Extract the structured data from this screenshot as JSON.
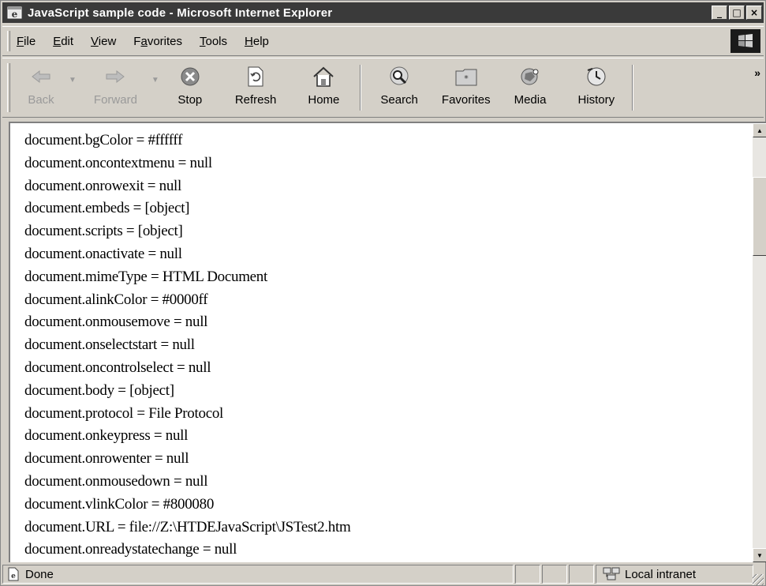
{
  "window": {
    "title": "JavaScript sample code - Microsoft Internet Explorer",
    "buttons": {
      "minimize": "_",
      "maximize": "□",
      "close": "×"
    }
  },
  "menu": {
    "items": [
      {
        "label": "File",
        "accel": "F"
      },
      {
        "label": "Edit",
        "accel": "E"
      },
      {
        "label": "View",
        "accel": "V"
      },
      {
        "label": "Favorites",
        "accel": "a"
      },
      {
        "label": "Tools",
        "accel": "T"
      },
      {
        "label": "Help",
        "accel": "H"
      }
    ]
  },
  "toolbar": {
    "back": "Back",
    "forward": "Forward",
    "stop": "Stop",
    "refresh": "Refresh",
    "home": "Home",
    "search": "Search",
    "favorites": "Favorites",
    "media": "Media",
    "history": "History",
    "more": "»"
  },
  "content": {
    "lines": [
      "document.bgColor = #ffffff",
      "document.oncontextmenu = null",
      "document.onrowexit = null",
      "document.embeds = [object]",
      "document.scripts = [object]",
      "document.onactivate = null",
      "document.mimeType = HTML Document",
      "document.alinkColor = #0000ff",
      "document.onmousemove = null",
      "document.onselectstart = null",
      "document.oncontrolselect = null",
      "document.body = [object]",
      "document.protocol = File Protocol",
      "document.onkeypress = null",
      "document.onrowenter = null",
      "document.onmousedown = null",
      "document.vlinkColor = #800080",
      "document.URL = file://Z:\\HTDEJavaScript\\JSTest2.htm",
      "document.onreadystatechange = null"
    ]
  },
  "status": {
    "text": "Done",
    "zone": "Local intranet"
  },
  "colors": {
    "title_bg": "#3a3a3a",
    "chrome": "#d4d0c8"
  }
}
